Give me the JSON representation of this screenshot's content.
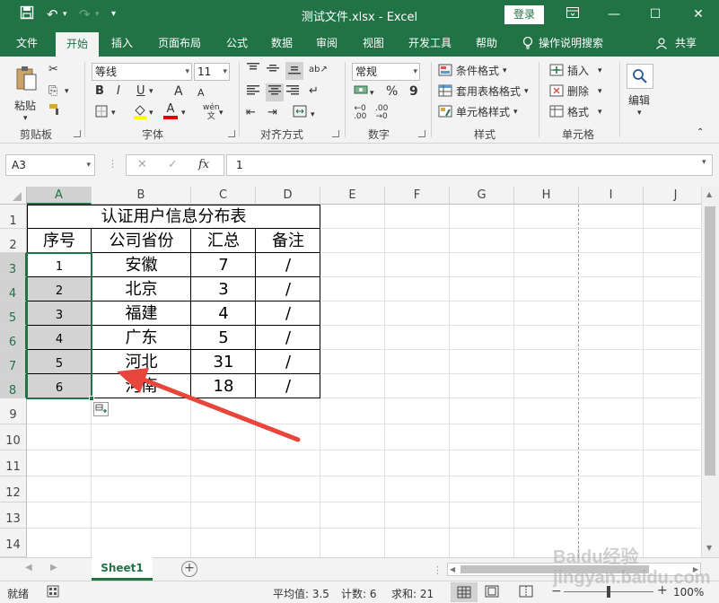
{
  "titlebar": {
    "title": "测试文件.xlsx  -  Excel",
    "login": "登录"
  },
  "tabs": [
    "文件",
    "开始",
    "插入",
    "页面布局",
    "公式",
    "数据",
    "审阅",
    "视图",
    "开发工具",
    "帮助",
    "操作说明搜索",
    "共享"
  ],
  "ribbon": {
    "clipboard": {
      "paste": "粘贴",
      "label": "剪贴板"
    },
    "font": {
      "name": "等线",
      "size": "11",
      "label": "字体",
      "bold": "B",
      "italic": "I",
      "underline": "U",
      "grow": "A",
      "shrink": "A",
      "wen": "wén"
    },
    "align": {
      "label": "对齐方式"
    },
    "number": {
      "format": "常规",
      "label": "数字",
      "percent": "%",
      "comma": "9"
    },
    "styles": {
      "conditional": "条件格式",
      "table": "套用表格格式",
      "cell": "单元格样式",
      "label": "样式"
    },
    "cells": {
      "insert": "插入",
      "delete": "删除",
      "format": "格式",
      "label": "单元格"
    },
    "editing": {
      "label": "编辑"
    }
  },
  "formula": {
    "namebox": "A3",
    "fx": "fx",
    "value": "1"
  },
  "columns": [
    "A",
    "B",
    "C",
    "D",
    "E",
    "F",
    "G",
    "H",
    "I",
    "J"
  ],
  "rows": [
    "1",
    "2",
    "3",
    "4",
    "5",
    "6",
    "7",
    "8",
    "9",
    "10",
    "11",
    "12",
    "13",
    "14"
  ],
  "table": {
    "title": "认证用户信息分布表",
    "headers": [
      "序号",
      "公司省份",
      "汇总",
      "备注"
    ],
    "data": [
      [
        "1",
        "安徽",
        "7",
        "/"
      ],
      [
        "2",
        "北京",
        "3",
        "/"
      ],
      [
        "3",
        "福建",
        "4",
        "/"
      ],
      [
        "4",
        "广东",
        "5",
        "/"
      ],
      [
        "5",
        "河北",
        "31",
        "/"
      ],
      [
        "6",
        "河南",
        "18",
        "/"
      ]
    ]
  },
  "sheets": {
    "active": "Sheet1",
    "add": "+"
  },
  "status": {
    "ready": "就绪",
    "average": "平均值: 3.5",
    "count": "计数: 6",
    "sum": "求和: 21",
    "zoom": "100%"
  },
  "watermark": "Baidu经验 jingyan.baidu.com",
  "colors": {
    "accent": "#217346",
    "arrow": "#e8453c"
  }
}
